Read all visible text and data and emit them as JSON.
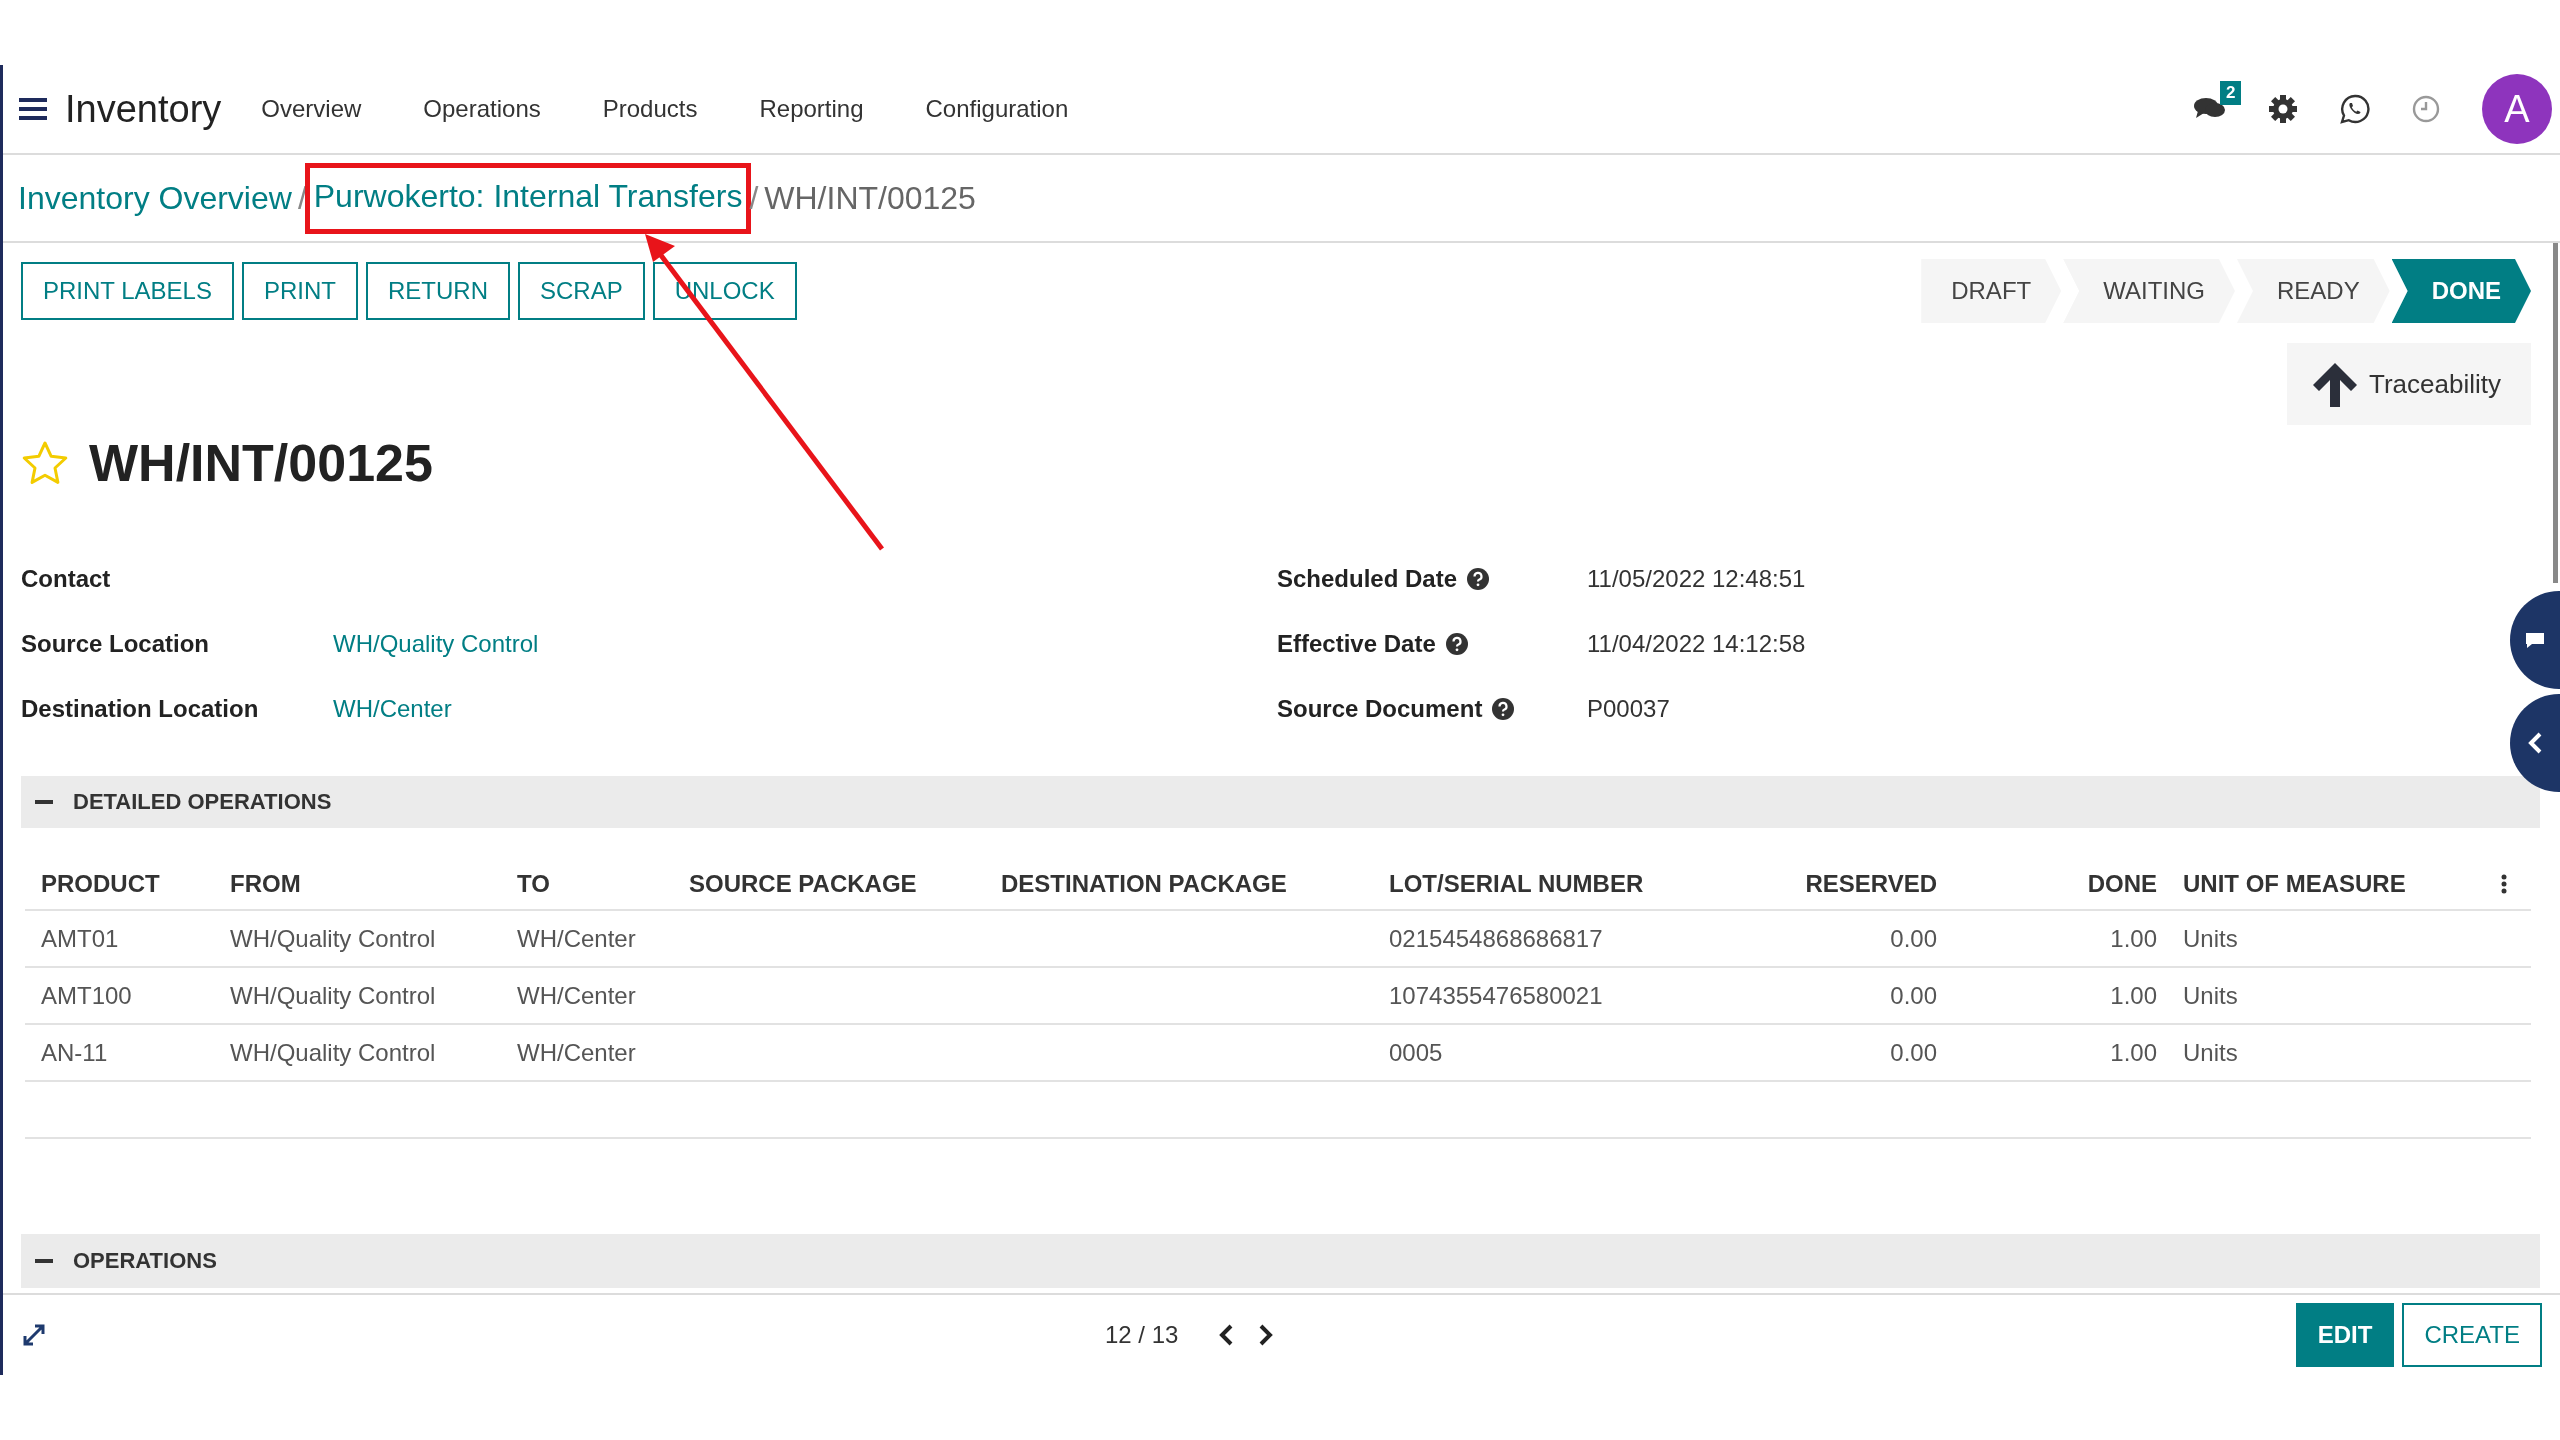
{
  "navbar": {
    "app_title": "Inventory",
    "menu": [
      "Overview",
      "Operations",
      "Products",
      "Reporting",
      "Configuration"
    ],
    "messages_badge": "2",
    "avatar": "A"
  },
  "breadcrumb": {
    "separator": "/",
    "items": [
      {
        "label": "Inventory Overview",
        "link": true,
        "highlighted": false
      },
      {
        "label": "Purwokerto: Internal Transfers",
        "link": true,
        "highlighted": true
      },
      {
        "label": "WH/INT/00125",
        "link": false,
        "highlighted": false
      }
    ]
  },
  "actions": [
    "PRINT LABELS",
    "PRINT",
    "RETURN",
    "SCRAP",
    "UNLOCK"
  ],
  "stages": [
    {
      "label": "DRAFT",
      "selected": false
    },
    {
      "label": "WAITING",
      "selected": false
    },
    {
      "label": "READY",
      "selected": false
    },
    {
      "label": "DONE",
      "selected": true
    }
  ],
  "smart_button": "Traceability",
  "record": {
    "title": "WH/INT/00125",
    "starred": false
  },
  "fields_left": [
    {
      "label": "Contact"
    },
    {
      "label": "Source Location",
      "value": "WH/Quality Control",
      "link": true
    },
    {
      "label": "Destination Location",
      "value": "WH/Center",
      "link": true
    }
  ],
  "fields_right": [
    {
      "label": "Scheduled Date",
      "value": "11/05/2022 12:48:51",
      "help": true,
      "link": false
    },
    {
      "label": "Effective Date",
      "value": "11/04/2022 14:12:58",
      "help": true,
      "link": false
    },
    {
      "label": "Source Document",
      "value": "P00037",
      "help": true,
      "link": false
    }
  ],
  "detailed_operations": {
    "title": "DETAILED OPERATIONS",
    "expanded": true,
    "columns": [
      {
        "label": "PRODUCT",
        "numeric": false
      },
      {
        "label": "FROM",
        "numeric": false
      },
      {
        "label": "TO",
        "numeric": false
      },
      {
        "label": "SOURCE PACKAGE",
        "numeric": false
      },
      {
        "label": "DESTINATION PACKAGE",
        "numeric": false
      },
      {
        "label": "LOT/SERIAL NUMBER",
        "numeric": false
      },
      {
        "label": "RESERVED",
        "numeric": true
      },
      {
        "label": "DONE",
        "numeric": true
      },
      {
        "label": "UNIT OF MEASURE",
        "numeric": false
      }
    ],
    "rows": [
      {
        "product": "AMT01",
        "from": "WH/Quality Control",
        "to": "WH/Center",
        "lot_serial_number": "0215454868686817",
        "reserved": "0.00",
        "done": "1.00",
        "unit_of_measure": "Units"
      },
      {
        "product": "AMT100",
        "from": "WH/Quality Control",
        "to": "WH/Center",
        "lot_serial_number": "1074355476580021",
        "reserved": "0.00",
        "done": "1.00",
        "unit_of_measure": "Units"
      },
      {
        "product": "AN-11",
        "from": "WH/Quality Control",
        "to": "WH/Center",
        "lot_serial_number": "0005",
        "reserved": "0.00",
        "done": "1.00",
        "unit_of_measure": "Units"
      }
    ]
  },
  "operations": {
    "title": "OPERATIONS",
    "expanded": true
  },
  "pager": "12 / 13",
  "buttons": [
    {
      "label": "EDIT",
      "primary": true
    },
    {
      "label": "CREATE",
      "primary": false
    }
  ]
}
